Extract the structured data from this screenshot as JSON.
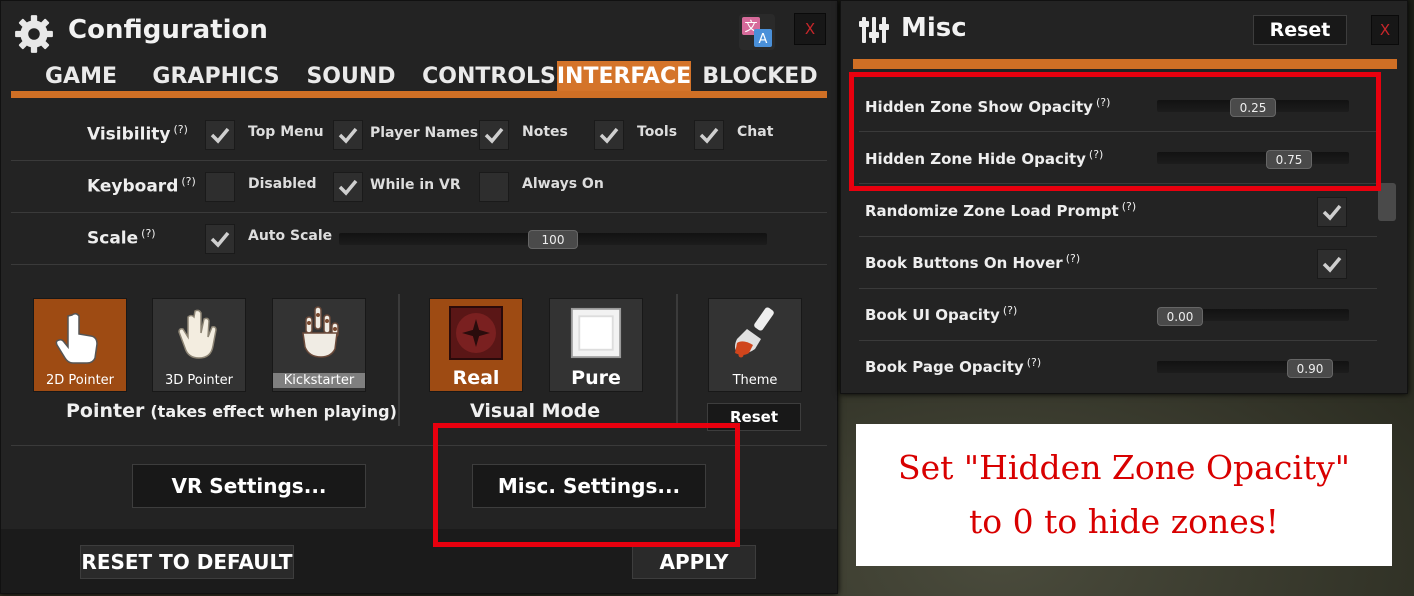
{
  "config": {
    "title": "Configuration",
    "close": "X",
    "tabs": [
      "GAME",
      "GRAPHICS",
      "SOUND",
      "CONTROLS",
      "INTERFACE",
      "BLOCKED"
    ],
    "active_tab": "INTERFACE",
    "visibility": {
      "label": "Visibility",
      "help": "(?)",
      "options": [
        {
          "label": "Top Menu",
          "checked": true
        },
        {
          "label": "Player Names",
          "checked": true
        },
        {
          "label": "Notes",
          "checked": true
        },
        {
          "label": "Tools",
          "checked": true
        },
        {
          "label": "Chat",
          "checked": true
        }
      ]
    },
    "keyboard": {
      "label": "Keyboard",
      "help": "(?)",
      "options": [
        {
          "label": "Disabled",
          "checked": false
        },
        {
          "label": "While in VR",
          "checked": true
        },
        {
          "label": "Always On",
          "checked": false
        }
      ]
    },
    "scale": {
      "label": "Scale",
      "help": "(?)",
      "auto_label": "Auto Scale",
      "auto_checked": true,
      "value": "100"
    },
    "pointer": {
      "options": [
        "2D Pointer",
        "3D Pointer",
        "Kickstarter"
      ],
      "selected": "2D Pointer",
      "caption": "Pointer",
      "note": "(takes effect when playing)"
    },
    "visual_mode": {
      "options": [
        "Real",
        "Pure"
      ],
      "selected": "Real",
      "caption": "Visual Mode"
    },
    "theme": {
      "label": "Theme",
      "reset": "Reset"
    },
    "vr_settings": "VR Settings...",
    "misc_settings": "Misc. Settings...",
    "reset_default": "RESET TO DEFAULT",
    "apply": "APPLY"
  },
  "misc": {
    "title": "Misc",
    "reset": "Reset",
    "close": "X",
    "help": "(?)",
    "rows": {
      "hidden_show": {
        "label": "Hidden Zone Show Opacity",
        "value": "0.25",
        "fraction": 0.25
      },
      "hidden_hide": {
        "label": "Hidden Zone Hide Opacity",
        "value": "0.75",
        "fraction": 0.75
      },
      "randomize": {
        "label": "Randomize Zone Load Prompt",
        "checked": true
      },
      "book_buttons": {
        "label": "Book Buttons On Hover",
        "checked": true
      },
      "book_ui": {
        "label": "Book UI Opacity",
        "value": "0.00",
        "fraction": 0.0
      },
      "book_page": {
        "label": "Book Page Opacity",
        "value": "0.90",
        "fraction": 0.9
      }
    }
  },
  "callout": {
    "line1": "Set \"Hidden Zone Opacity\"",
    "line2": "to 0 to hide zones!"
  },
  "colors": {
    "accent": "#d4742a",
    "highlight": "#e8000e",
    "panel": "#232323"
  }
}
